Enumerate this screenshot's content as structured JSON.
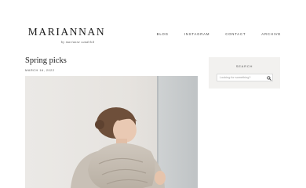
{
  "site": {
    "title": "MARIANNAN",
    "byline": "by marianne sundelid"
  },
  "nav": {
    "items": [
      "BLOG",
      "INSTAGRAM",
      "CONTACT",
      "ARCHIVE"
    ]
  },
  "post": {
    "title": "Spring picks",
    "date": "MARCH 16, 2022"
  },
  "sidebar": {
    "search": {
      "heading": "SEARCH",
      "placeholder": "Looking for something?",
      "icon": "search-icon"
    }
  },
  "colors": {
    "background": "#ffffff",
    "sidebar_bg": "#f2f1ef",
    "text": "#222222"
  }
}
